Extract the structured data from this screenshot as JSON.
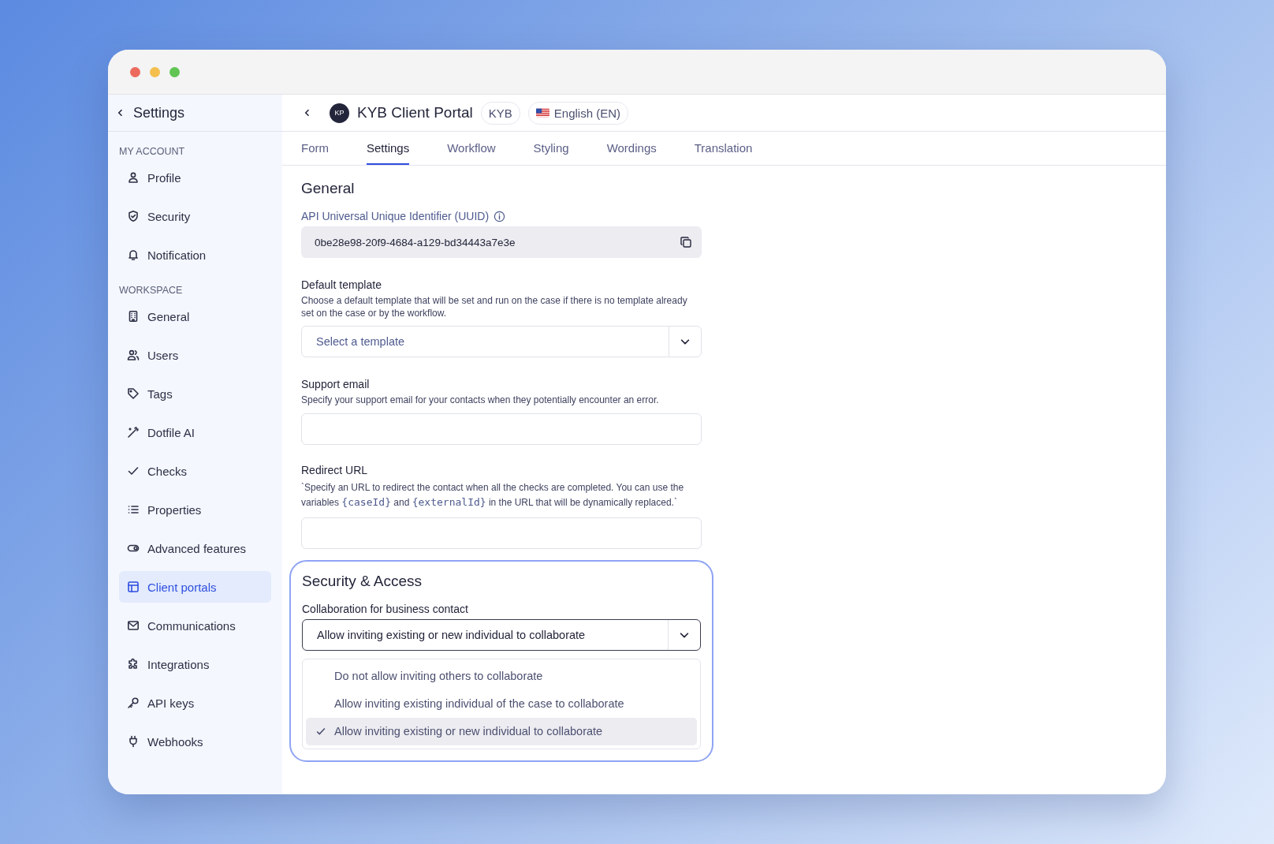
{
  "window": {
    "controls": [
      {
        "color": "#ec6a5e"
      },
      {
        "color": "#f4bf4f"
      },
      {
        "color": "#61c554"
      }
    ]
  },
  "sidebar": {
    "title": "Settings",
    "groups": [
      {
        "heading": "MY ACCOUNT",
        "items": [
          {
            "label": "Profile",
            "selected": false
          },
          {
            "label": "Security",
            "selected": false
          },
          {
            "label": "Notification",
            "selected": false
          }
        ]
      },
      {
        "heading": "WORKSPACE",
        "items": [
          {
            "label": "General",
            "selected": false
          },
          {
            "label": "Users",
            "selected": false
          },
          {
            "label": "Tags",
            "selected": false
          },
          {
            "label": "Dotfile AI",
            "selected": false
          },
          {
            "label": "Checks",
            "selected": false
          },
          {
            "label": "Properties",
            "selected": false
          },
          {
            "label": "Advanced features",
            "selected": false
          },
          {
            "label": "Client portals",
            "selected": true
          },
          {
            "label": "Communications",
            "selected": false
          },
          {
            "label": "Integrations",
            "selected": false
          },
          {
            "label": "API keys",
            "selected": false
          },
          {
            "label": "Webhooks",
            "selected": false
          }
        ]
      }
    ]
  },
  "header": {
    "avatar": "KP",
    "title": "KYB Client Portal",
    "badges": [
      {
        "label": "KYB",
        "kind": "text"
      },
      {
        "label": "English (EN)",
        "kind": "flag"
      }
    ]
  },
  "tabs": [
    {
      "label": "Form",
      "selected": false
    },
    {
      "label": "Settings",
      "selected": true
    },
    {
      "label": "Workflow",
      "selected": false
    },
    {
      "label": "Styling",
      "selected": false
    },
    {
      "label": "Wordings",
      "selected": false
    },
    {
      "label": "Translation",
      "selected": false
    }
  ],
  "general": {
    "title": "General",
    "uuid": {
      "label": "API Universal Unique Identifier (UUID)",
      "value": "0be28e98-20f9-4684-a129-bd34443a7e3e"
    },
    "default_template": {
      "label": "Default template",
      "description": "Choose a default template that will be set and run on the case if there is no template already set on the case or by the workflow.",
      "placeholder": "Select a template"
    },
    "support_email": {
      "label": "Support email",
      "description": "Specify your support email for your contacts when they potentially encounter an error."
    },
    "redirect_url": {
      "label": "Redirect URL",
      "description": [
        {
          "kind": "text",
          "text": "`Specify an URL to redirect the contact when all the checks are completed. You can use the variables "
        },
        {
          "kind": "code",
          "text": "{caseId}"
        },
        {
          "kind": "text",
          "text": " and "
        },
        {
          "kind": "code",
          "text": "{externalId}"
        },
        {
          "kind": "text",
          "text": " in the URL that will be dynamically replaced.`"
        }
      ]
    }
  },
  "security": {
    "title": "Security & Access",
    "collaboration": {
      "label": "Collaboration for business contact",
      "value": "Allow inviting existing or new individual to collaborate",
      "expanded": true,
      "options": [
        {
          "label": "Do not allow inviting others to collaborate",
          "selected": false
        },
        {
          "label": "Allow inviting existing individual of the case to collaborate",
          "selected": false
        },
        {
          "label": "Allow inviting existing or new individual to collaborate",
          "selected": true
        }
      ]
    }
  }
}
